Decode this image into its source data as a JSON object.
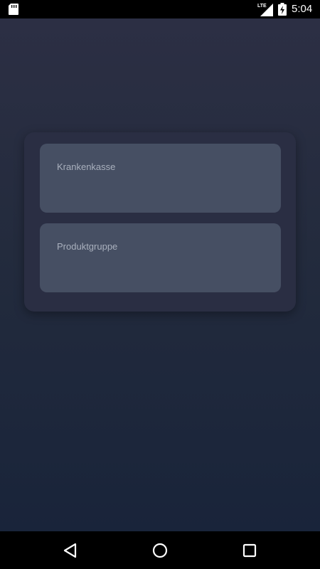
{
  "status_bar": {
    "time": "5:04",
    "network_label": "LTE",
    "icons": [
      "sd-card-icon",
      "lte-signal-icon",
      "battery-charging-icon"
    ]
  },
  "form": {
    "fields": [
      {
        "label": "Krankenkasse"
      },
      {
        "label": "Produktgruppe"
      }
    ]
  },
  "nav_bar": {
    "icons": [
      "back-icon",
      "home-icon",
      "recents-icon"
    ]
  },
  "colors": {
    "background_top": "#2c2f44",
    "background_bottom": "#19243a",
    "card": "#2a2e43",
    "field": "#464f63",
    "label_text": "#a9b0bd"
  }
}
